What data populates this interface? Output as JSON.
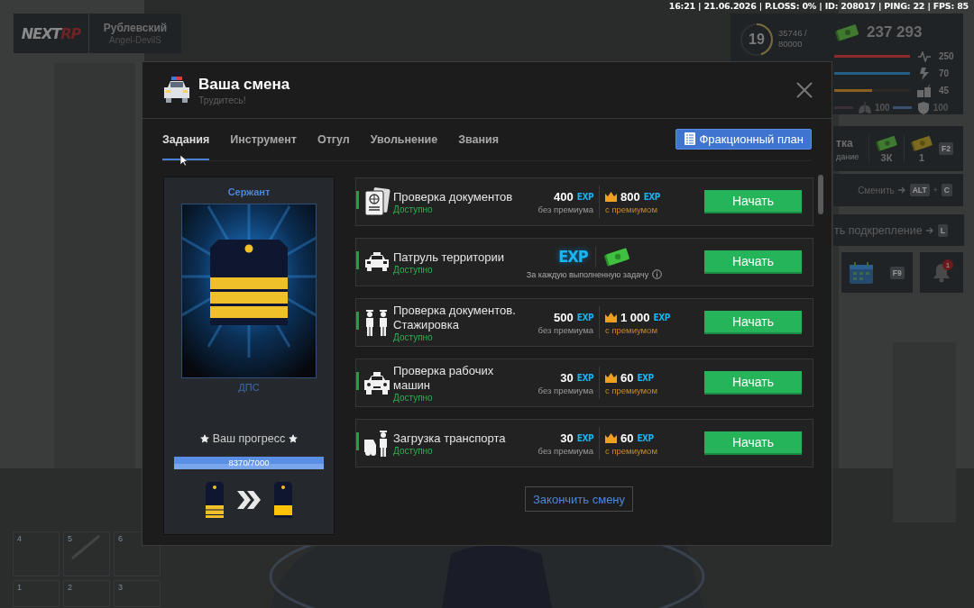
{
  "status_bar": {
    "text": "16:21 | 21.06.2026 | P.LOSS: 0% | ID: 208017 | PING: 22 | FPS: 85"
  },
  "hud": {
    "logo": {
      "part_1": "NEXT",
      "part_2": "RP"
    },
    "player": {
      "name": "Рублевский",
      "login": "Angel-DevilS"
    },
    "level": {
      "value": "19",
      "progress": "35746 /",
      "target": "80000"
    },
    "money": "237 293",
    "stats": [
      {
        "kind": "health",
        "value": "250",
        "level": 1,
        "color": "#8e2a2a"
      },
      {
        "kind": "energy",
        "value": "70",
        "level": 1,
        "color": "#235f85"
      },
      {
        "kind": "food",
        "value": "45",
        "level": 0.5,
        "color": "#8a6020"
      }
    ],
    "sub_stats": [
      {
        "kind": "lungs",
        "value": "100",
        "level": 1,
        "color": "#3c3038"
      },
      {
        "kind": "armor",
        "value": "100",
        "level": 1,
        "color": "#3e5070"
      }
    ],
    "bonus": {
      "title": "тка",
      "subtitle": "дание",
      "cash": "3К",
      "gold": "1",
      "key": "F2"
    },
    "switch": {
      "label": "Сменить",
      "keys": [
        {
          "kind": "key",
          "label": "ALT"
        },
        {
          "kind": "plus",
          "label": "+"
        },
        {
          "kind": "key",
          "label": "C"
        }
      ]
    },
    "backup": {
      "label": "ть подкрепление",
      "key": "L"
    },
    "calendar": {
      "key": "F9"
    },
    "notifications": {
      "count": "1"
    },
    "hotbar": [
      {
        "label": "4"
      },
      {
        "label": "5"
      },
      {
        "label": "6"
      },
      {
        "label": "1"
      },
      {
        "label": "2"
      },
      {
        "label": "3"
      }
    ]
  },
  "modal": {
    "title": "Ваша смена",
    "subtitle": "Трудитесь!",
    "tabs": [
      {
        "label": "Задания",
        "selected": true
      },
      {
        "label": "Инструмент",
        "selected": false
      },
      {
        "label": "Отгул",
        "selected": false
      },
      {
        "label": "Увольнение",
        "selected": false
      },
      {
        "label": "Звания",
        "selected": false
      }
    ],
    "plan_button": "Фракционный план",
    "rank": {
      "title": "Сержант",
      "unit": "ДПС",
      "progress_label": "Ваш прогресс",
      "progress_text": "8370/7000",
      "level": 1
    },
    "tasks": [
      {
        "kind": "exp",
        "title": "Проверка документов",
        "status": "Доступно",
        "base": {
          "value": "400",
          "unit": "EXP",
          "caption": "без премиума"
        },
        "premium": {
          "value": "800",
          "unit": "EXP",
          "caption": "с премиумом"
        },
        "button": "Начать"
      },
      {
        "kind": "reward",
        "title": "Патруль территории",
        "status": "Доступно",
        "reward_unit": "EXP",
        "note": "За каждую выполненную задачу",
        "button": "Начать"
      },
      {
        "kind": "exp",
        "title": "Проверка документов. Стажировка",
        "status": "Доступно",
        "base": {
          "value": "500",
          "unit": "EXP",
          "caption": "без премиума"
        },
        "premium": {
          "value": "1 000",
          "unit": "EXP",
          "caption": "с премиумом"
        },
        "button": "Начать"
      },
      {
        "kind": "exp",
        "title": "Проверка рабочих машин",
        "status": "Доступно",
        "base": {
          "value": "30",
          "unit": "EXP",
          "caption": "без премиума"
        },
        "premium": {
          "value": "60",
          "unit": "EXP",
          "caption": "с премиумом"
        },
        "button": "Начать"
      },
      {
        "kind": "exp",
        "title": "Загрузка транспорта",
        "status": "Доступно",
        "base": {
          "value": "30",
          "unit": "EXP",
          "caption": "без премиума"
        },
        "premium": {
          "value": "60",
          "unit": "EXP",
          "caption": "с премиумом"
        },
        "button": "Начать"
      }
    ],
    "finish_button": "Закончить смену"
  }
}
